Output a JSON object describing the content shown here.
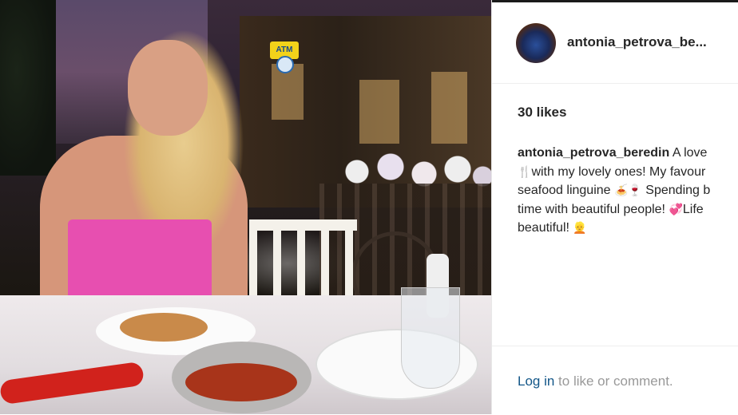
{
  "photo": {
    "sign_text": "ATM"
  },
  "post": {
    "username": "antonia_petrova_be...",
    "likes": "30 likes",
    "caption": {
      "username": "antonia_petrova_beredin",
      "line1": " A love",
      "line2": "with my lovely ones! My favour",
      "line3": "seafood linguine ",
      "line3b": " Spending b",
      "line4": "time with beautiful people! ",
      "line4b": "Life",
      "line5": "beautiful! ",
      "emoji_fork": "🍴",
      "emoji_plate": "🍝",
      "emoji_wine": "🍷",
      "emoji_hearts": "💞",
      "emoji_face": "👱"
    }
  },
  "footer": {
    "login_link": "Log in",
    "login_text": " to like or comment."
  }
}
